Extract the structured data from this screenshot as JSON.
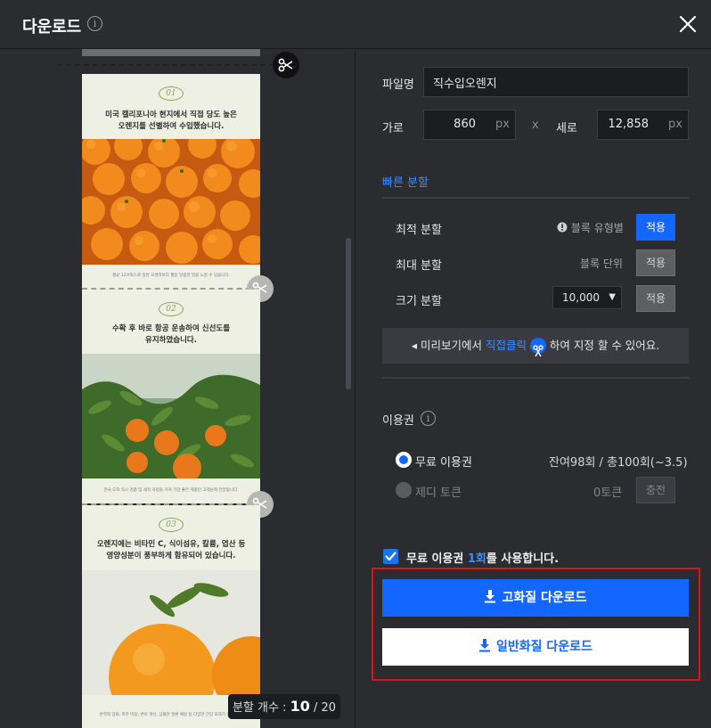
{
  "header": {
    "title": "다운로드",
    "info_glyph": "i"
  },
  "preview": {
    "cards": [
      {
        "num": "01",
        "line1": "미국 캘리포니아 현지에서 직접 당도 높은",
        "line2": "오렌지를 선별하여 수입했습니다.",
        "foot": "평균 12브릭스로 일반 오렌지보다 월등 달콤한 맛을 느낄 수 있습니다."
      },
      {
        "num": "02",
        "line1": "수확 후 바로 항공 운송하여 신선도를",
        "line2": "유지하였습니다.",
        "foot": "한국 도착 즉시 검품 및 세척 과정을 거쳐 가장 좋은 제품만 고객님께 전달됩니다."
      },
      {
        "num": "03",
        "line1": "오렌지에는 비타민 C, 식이섬유, 칼륨, 엽산 등",
        "line2": "영양성분이 풍부하게 함유되어 있습니다.",
        "foot": "면역력 강화, 피부 미용, 변비 개선, 심혈관 질환 예방 등 다양한 건강 효과가 있습니다."
      }
    ],
    "split_count": {
      "label": "분할 개수 :",
      "current": "10",
      "sep": "/",
      "total": "20"
    }
  },
  "form": {
    "filename_label": "파일명",
    "filename_value": "직수입오렌지",
    "width_label": "가로",
    "width_value": "860",
    "width_unit": "px",
    "x_sep": "x",
    "height_label": "세로",
    "height_value": "12,858",
    "height_unit": "px"
  },
  "quick_split": {
    "title": "빠른 분할",
    "rows": [
      {
        "label": "최적 분할",
        "sub": "블록 유형별",
        "apply": "적용"
      },
      {
        "label": "최대 분할",
        "sub": "블록 단위",
        "apply": "적용"
      },
      {
        "label": "크기 분할",
        "select": "10,000",
        "apply": "적용"
      }
    ],
    "hint_prefix": "◂ 미리보기에서 ",
    "hint_blue": "직접클릭",
    "hint_suffix": " 하여 지정 할 수 있어요."
  },
  "license": {
    "title": "이용권",
    "free_label": "무료 이용권",
    "free_remaining": "잔여98회 / 총100회(~3.5)",
    "token_label": "제디 토큰",
    "token_value": "0토큰",
    "charge": "충전"
  },
  "confirm": {
    "prefix": "무료 이용권 ",
    "count": "1회",
    "suffix": "를 사용합니다."
  },
  "buttons": {
    "high_quality": "고화질 다운로드",
    "normal_quality": "일반화질 다운로드"
  },
  "colors": {
    "accent": "#1366ff",
    "highlight_frame": "#e0101a",
    "bg": "#2b2c30"
  }
}
